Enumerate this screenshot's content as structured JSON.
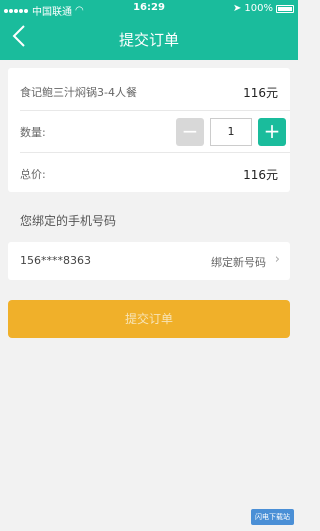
{
  "statusbar": {
    "carrier": "中国联通",
    "time": "16:29",
    "battery": "100%"
  },
  "header": {
    "title": "提交订单"
  },
  "order": {
    "item_name": "食记鲍三汁焖锅3-4人餐",
    "item_price": "116元",
    "quantity_label": "数量:",
    "quantity": "1",
    "total_label": "总价:",
    "total_price": "116元"
  },
  "phone": {
    "section_title": "您绑定的手机号码",
    "number": "156****8363",
    "rebind_label": "绑定新号码"
  },
  "submit_label": "提交订单",
  "watermark": "闪电下载站",
  "colors": {
    "accent": "#1abc9c",
    "submit": "#f0b02a"
  }
}
